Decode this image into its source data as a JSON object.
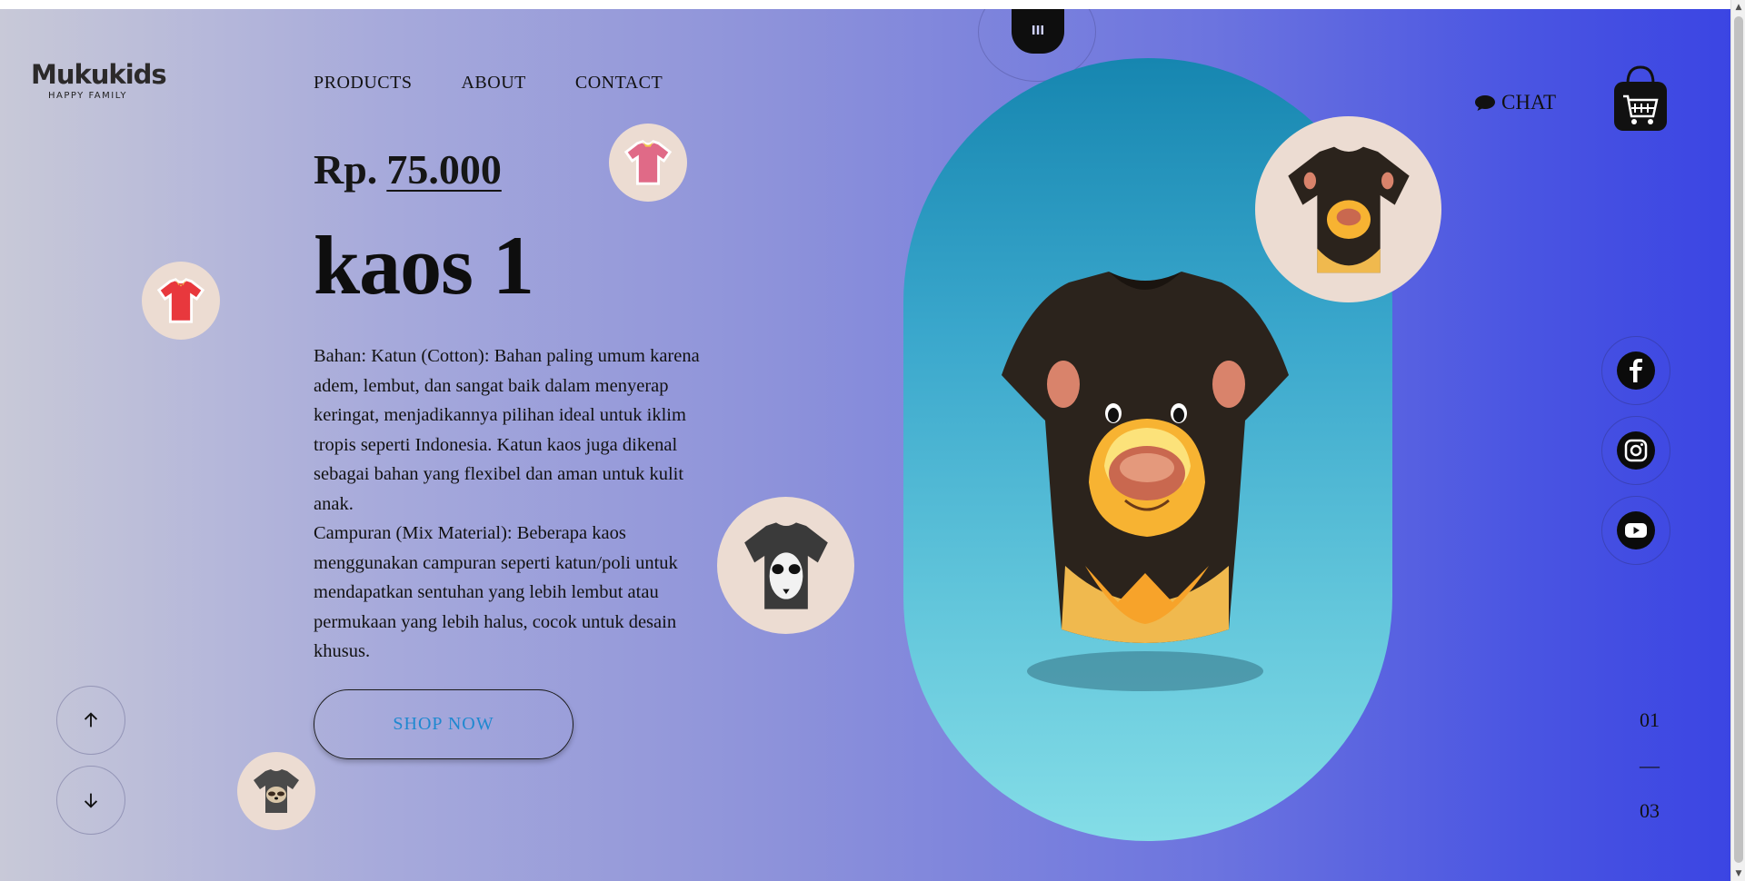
{
  "brand": {
    "name": "Mukukids",
    "tagline": "HAPPY FAMILY"
  },
  "nav": {
    "items": [
      "PRODUCTS",
      "ABOUT",
      "CONTACT"
    ]
  },
  "product": {
    "currency": "Rp.",
    "price": "75.000",
    "name": "kaos 1",
    "description": [
      "Bahan: Katun (Cotton): Bahan paling umum karena adem, lembut, dan sangat baik dalam menyerap keringat, menjadikannya pilihan ideal untuk iklim tropis seperti Indonesia. Katun kaos juga dikenal sebagai bahan yang flexibel dan aman untuk kulit anak.",
      "Campuran (Mix Material): Beberapa kaos menggunakan campuran seperti katun/poli untuk mendapatkan sentuhan yang lebih lembut atau permukaan yang lebih halus, cocok untuk desain khusus."
    ],
    "cta": "SHOP NOW"
  },
  "header": {
    "chat_label": "CHAT",
    "topdeco_label": "III"
  },
  "slider": {
    "current": "01",
    "separator": "—",
    "total": "03"
  },
  "icons": {
    "chat": "chat-bubble-icon",
    "cart": "shopping-bag-icon",
    "facebook": "facebook-icon",
    "instagram": "instagram-icon",
    "youtube": "youtube-icon",
    "up": "arrow-up-icon",
    "down": "arrow-down-icon"
  },
  "colors": {
    "accent": "#1e88d0",
    "pill_top": "#1686b0",
    "pill_bottom": "#84dde7",
    "bg_right": "#3b45e3"
  }
}
